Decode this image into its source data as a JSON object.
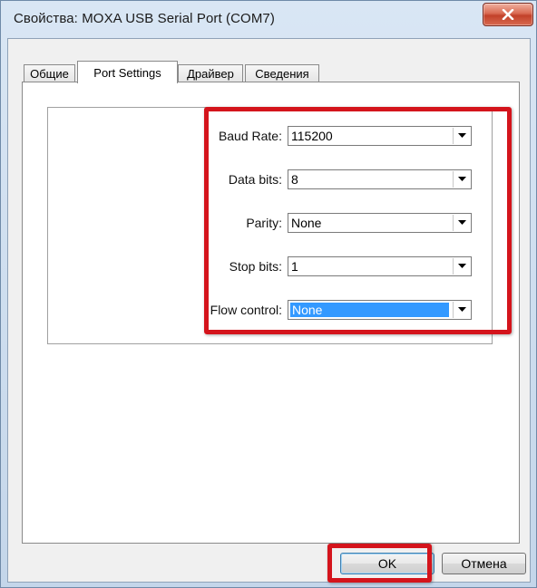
{
  "window": {
    "title": "Свойства: MOXA USB Serial Port (COM7)"
  },
  "tabs": [
    {
      "label": "Общие",
      "active": false
    },
    {
      "label": "Port Settings",
      "active": true
    },
    {
      "label": "Драйвер",
      "active": false
    },
    {
      "label": "Сведения",
      "active": false
    }
  ],
  "settings": {
    "baud_rate": {
      "label": "Baud Rate:",
      "value": "115200"
    },
    "data_bits": {
      "label": "Data bits:",
      "value": "8"
    },
    "parity": {
      "label": "Parity:",
      "value": "None"
    },
    "stop_bits": {
      "label": "Stop bits:",
      "value": "1"
    },
    "flow_control": {
      "label": "Flow control:",
      "value": "None"
    }
  },
  "buttons": {
    "ok_label": "OK",
    "cancel_label": "Отмена"
  },
  "icons": {
    "close": "close-x-icon",
    "dropdown": "chevron-down-icon"
  },
  "colors": {
    "highlight": "#d4141c",
    "selection": "#3399ff",
    "close_button": "#c2412a"
  }
}
